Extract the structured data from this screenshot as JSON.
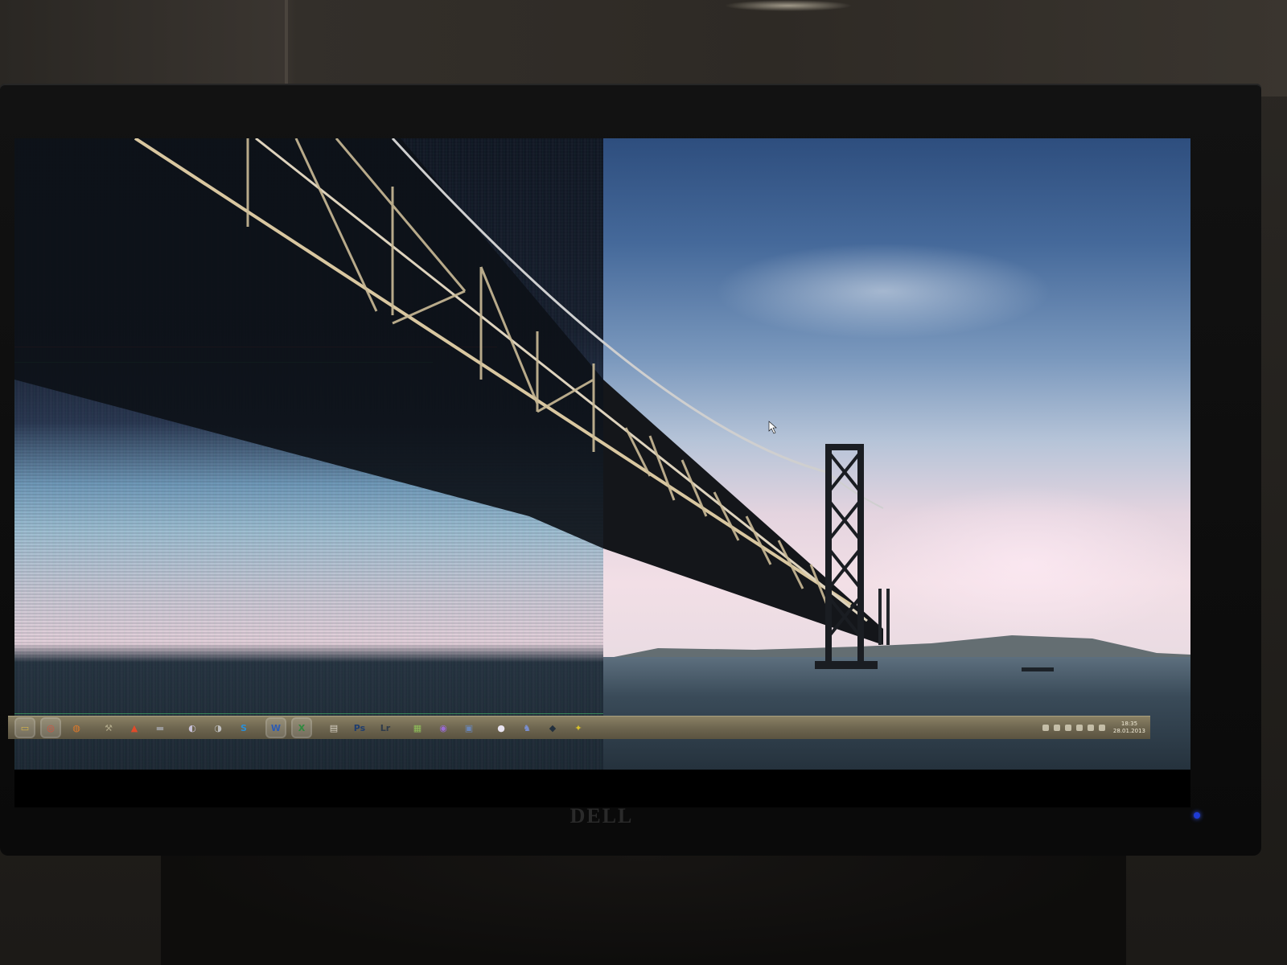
{
  "monitor": {
    "brand_logo": "DELL",
    "power_led_color": "#1e3bd6",
    "screen_state": "left half corrupted"
  },
  "desktop": {
    "wallpaper": "suspension bridge over sea"
  },
  "taskbar": {
    "groups": [
      {
        "icons": [
          {
            "name": "explorer-icon",
            "glyph": "▭",
            "color": "#d8b64a",
            "active": true
          },
          {
            "name": "chrome-icon",
            "glyph": "◎",
            "color": "#d9503c",
            "active": true
          },
          {
            "name": "firefox-icon",
            "glyph": "◍",
            "color": "#e07a2a",
            "active": false
          }
        ]
      },
      {
        "icons": [
          {
            "name": "app-tools-icon",
            "glyph": "⚒",
            "color": "#b0a889",
            "active": false
          },
          {
            "name": "app-triangle-icon",
            "glyph": "▲",
            "color": "#e24a2a",
            "active": false
          },
          {
            "name": "app-folder-icon",
            "glyph": "▬",
            "color": "#9a9a9a",
            "active": false
          }
        ]
      },
      {
        "icons": [
          {
            "name": "app-chat-icon",
            "glyph": "◐",
            "color": "#c7c0d6",
            "active": false
          },
          {
            "name": "app-media-icon",
            "glyph": "◑",
            "color": "#bfbfbf",
            "active": false
          },
          {
            "name": "skype-icon",
            "glyph": "S",
            "color": "#2a8fd8",
            "active": false
          }
        ]
      },
      {
        "icons": [
          {
            "name": "word-icon",
            "glyph": "W",
            "color": "#2b5bb5",
            "active": true
          },
          {
            "name": "excel-icon",
            "glyph": "X",
            "color": "#2f8a3e",
            "active": true
          }
        ]
      },
      {
        "icons": [
          {
            "name": "pdf-icon",
            "glyph": "▤",
            "color": "#d9d3c6",
            "active": false
          },
          {
            "name": "photoshop-icon",
            "glyph": "Ps",
            "color": "#1f3d6e",
            "active": false
          },
          {
            "name": "lightroom-icon",
            "glyph": "Lr",
            "color": "#2f3b4a",
            "active": false
          }
        ]
      },
      {
        "icons": [
          {
            "name": "app-notes-icon",
            "glyph": "▦",
            "color": "#8fbf5a",
            "active": false
          },
          {
            "name": "app-purple-icon",
            "glyph": "◉",
            "color": "#9a6ad6",
            "active": false
          },
          {
            "name": "app-calendar-icon",
            "glyph": "▣",
            "color": "#6a86b8",
            "active": false
          }
        ]
      },
      {
        "icons": [
          {
            "name": "app-round-icon",
            "glyph": "●",
            "color": "#e9e4f0",
            "active": false
          },
          {
            "name": "app-character-icon",
            "glyph": "♞",
            "color": "#7a8fd0",
            "active": false
          },
          {
            "name": "app-dark-icon",
            "glyph": "◆",
            "color": "#23303d",
            "active": false
          },
          {
            "name": "app-green-icon",
            "glyph": "✦",
            "color": "#d8c12a",
            "active": false
          }
        ]
      }
    ],
    "tray": {
      "clock_time": "18:35",
      "clock_date": "28.01.2013"
    }
  }
}
